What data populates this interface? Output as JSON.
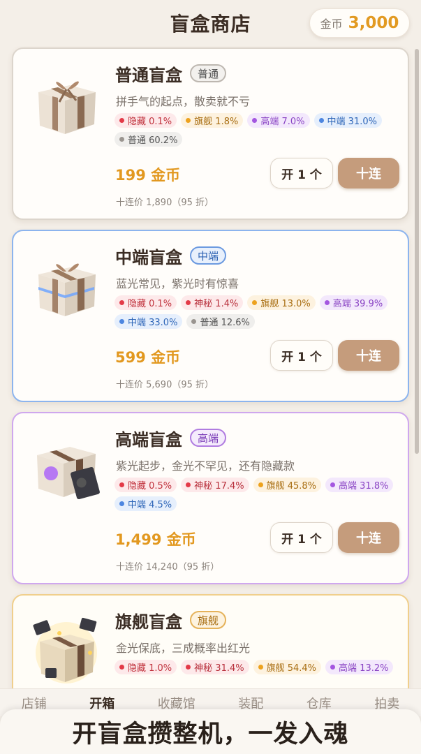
{
  "header": {
    "title": "盲盒商店",
    "coin_label": "金币",
    "coin_value": "3,000"
  },
  "boxes": [
    {
      "name": "普通盲盒",
      "badge": "普通",
      "desc": "拼手气的起点，散卖就不亏",
      "odds": [
        {
          "tier": "hidden",
          "text": "隐藏 0.1%"
        },
        {
          "tier": "flagship",
          "text": "旗舰 1.8%"
        },
        {
          "tier": "high",
          "text": "高端 7.0%"
        },
        {
          "tier": "mid",
          "text": "中端 31.0%"
        },
        {
          "tier": "normal",
          "text": "普通 60.2%"
        }
      ],
      "price": "199 金币",
      "ten_price": "十连价 1,890（95 折）",
      "btn_one": "开 1 个",
      "btn_ten": "十连"
    },
    {
      "name": "中端盲盒",
      "badge": "中端",
      "desc": "蓝光常见，紫光时有惊喜",
      "odds": [
        {
          "tier": "hidden",
          "text": "隐藏 0.1%"
        },
        {
          "tier": "mystic",
          "text": "神秘 1.4%"
        },
        {
          "tier": "flagship",
          "text": "旗舰 13.0%"
        },
        {
          "tier": "high",
          "text": "高端 39.9%"
        },
        {
          "tier": "mid",
          "text": "中端 33.0%"
        },
        {
          "tier": "normal",
          "text": "普通 12.6%"
        }
      ],
      "price": "599 金币",
      "ten_price": "十连价 5,690（95 折）",
      "btn_one": "开 1 个",
      "btn_ten": "十连"
    },
    {
      "name": "高端盲盒",
      "badge": "高端",
      "desc": "紫光起步，金光不罕见，还有隐藏款",
      "odds": [
        {
          "tier": "hidden",
          "text": "隐藏 0.5%"
        },
        {
          "tier": "mystic",
          "text": "神秘 17.4%"
        },
        {
          "tier": "flagship",
          "text": "旗舰 45.8%"
        },
        {
          "tier": "high",
          "text": "高端 31.8%"
        },
        {
          "tier": "mid",
          "text": "中端 4.5%"
        }
      ],
      "price": "1,499 金币",
      "ten_price": "十连价 14,240（95 折）",
      "btn_one": "开 1 个",
      "btn_ten": "十连"
    },
    {
      "name": "旗舰盲盒",
      "badge": "旗舰",
      "desc": "金光保底，三成概率出红光",
      "odds": [
        {
          "tier": "hidden",
          "text": "隐藏 1.0%"
        },
        {
          "tier": "mystic",
          "text": "神秘 31.4%"
        },
        {
          "tier": "flagship",
          "text": "旗舰 54.4%"
        },
        {
          "tier": "high",
          "text": "高端 13.2%"
        }
      ]
    }
  ],
  "tabs": [
    "店铺",
    "开箱",
    "收藏馆",
    "装配",
    "仓库",
    "拍卖"
  ],
  "active_tab": "开箱",
  "slogan": "开盲盒攒整机，一发入魂",
  "colors": {
    "accent_gold": "#e2981f",
    "button_brown": "#c59c7c",
    "tier_blue": "#8cb4ee",
    "tier_purple": "#cfa7ee",
    "tier_gold": "#f0cf8c"
  }
}
